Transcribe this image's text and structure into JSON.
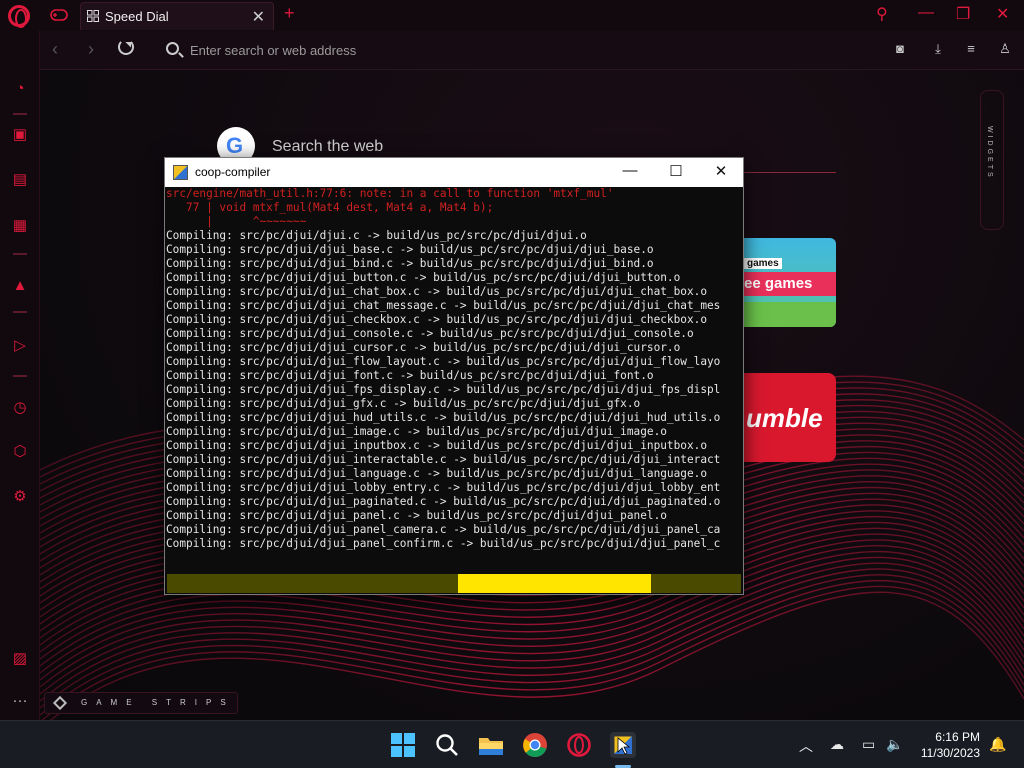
{
  "browser": {
    "tab_title": "Speed Dial",
    "address_placeholder": "Enter search or web address",
    "search_web_label": "Search the web",
    "google_letter": "G",
    "widgets_label": "WIDGETS",
    "game_strips_label": "GAME STRIPS",
    "tile_games_tag": "games",
    "tile_games_text": "ee games",
    "tile_humble_text": "umble",
    "accent_color": "#e0193c"
  },
  "console": {
    "title": "coop-compiler",
    "lines": [
      {
        "text": "src/engine/math_util.h:77:6: note: in a call to function 'mtxf_mul'",
        "kind": "note"
      },
      {
        "text": "   77 | void mtxf_mul(Mat4 dest, Mat4 a, Mat4 b);",
        "kind": "note"
      },
      {
        "text": "      |      ^~~~~~~~",
        "kind": "note"
      },
      {
        "text": "Compiling: src/pc/djui/djui.c -> build/us_pc/src/pc/djui/djui.o",
        "kind": "normal"
      },
      {
        "text": "Compiling: src/pc/djui/djui_base.c -> build/us_pc/src/pc/djui/djui_base.o",
        "kind": "normal"
      },
      {
        "text": "Compiling: src/pc/djui/djui_bind.c -> build/us_pc/src/pc/djui/djui_bind.o",
        "kind": "normal"
      },
      {
        "text": "Compiling: src/pc/djui/djui_button.c -> build/us_pc/src/pc/djui/djui_button.o",
        "kind": "normal"
      },
      {
        "text": "Compiling: src/pc/djui/djui_chat_box.c -> build/us_pc/src/pc/djui/djui_chat_box.o",
        "kind": "normal"
      },
      {
        "text": "Compiling: src/pc/djui/djui_chat_message.c -> build/us_pc/src/pc/djui/djui_chat_mes",
        "kind": "normal"
      },
      {
        "text": "Compiling: src/pc/djui/djui_checkbox.c -> build/us_pc/src/pc/djui/djui_checkbox.o",
        "kind": "normal"
      },
      {
        "text": "Compiling: src/pc/djui/djui_console.c -> build/us_pc/src/pc/djui/djui_console.o",
        "kind": "normal"
      },
      {
        "text": "Compiling: src/pc/djui/djui_cursor.c -> build/us_pc/src/pc/djui/djui_cursor.o",
        "kind": "normal"
      },
      {
        "text": "Compiling: src/pc/djui/djui_flow_layout.c -> build/us_pc/src/pc/djui/djui_flow_layo",
        "kind": "normal"
      },
      {
        "text": "Compiling: src/pc/djui/djui_font.c -> build/us_pc/src/pc/djui/djui_font.o",
        "kind": "normal"
      },
      {
        "text": "Compiling: src/pc/djui/djui_fps_display.c -> build/us_pc/src/pc/djui/djui_fps_displ",
        "kind": "normal"
      },
      {
        "text": "Compiling: src/pc/djui/djui_gfx.c -> build/us_pc/src/pc/djui/djui_gfx.o",
        "kind": "normal"
      },
      {
        "text": "Compiling: src/pc/djui/djui_hud_utils.c -> build/us_pc/src/pc/djui/djui_hud_utils.o",
        "kind": "normal"
      },
      {
        "text": "Compiling: src/pc/djui/djui_image.c -> build/us_pc/src/pc/djui/djui_image.o",
        "kind": "normal"
      },
      {
        "text": "Compiling: src/pc/djui/djui_inputbox.c -> build/us_pc/src/pc/djui/djui_inputbox.o",
        "kind": "normal"
      },
      {
        "text": "Compiling: src/pc/djui/djui_interactable.c -> build/us_pc/src/pc/djui/djui_interact",
        "kind": "normal"
      },
      {
        "text": "Compiling: src/pc/djui/djui_language.c -> build/us_pc/src/pc/djui/djui_language.o",
        "kind": "normal"
      },
      {
        "text": "Compiling: src/pc/djui/djui_lobby_entry.c -> build/us_pc/src/pc/djui/djui_lobby_ent",
        "kind": "normal"
      },
      {
        "text": "Compiling: src/pc/djui/djui_paginated.c -> build/us_pc/src/pc/djui/djui_paginated.o",
        "kind": "normal"
      },
      {
        "text": "Compiling: src/pc/djui/djui_panel.c -> build/us_pc/src/pc/djui/djui_panel.o",
        "kind": "normal"
      },
      {
        "text": "Compiling: src/pc/djui/djui_panel_camera.c -> build/us_pc/src/pc/djui/djui_panel_ca",
        "kind": "normal"
      },
      {
        "text": "Compiling: src/pc/djui/djui_panel_confirm.c -> build/us_pc/src/pc/djui/djui_panel_c",
        "kind": "normal"
      }
    ],
    "progress_color": "#ffe500"
  },
  "taskbar": {
    "time": "6:16 PM",
    "date": "11/30/2023"
  }
}
